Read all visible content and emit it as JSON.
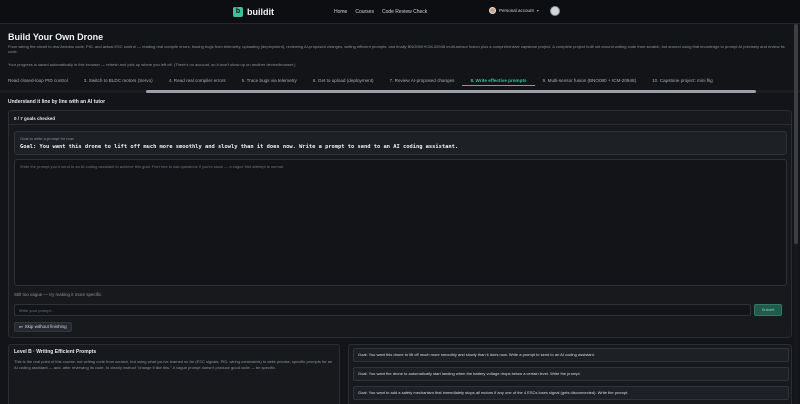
{
  "brand": {
    "logo_letter": "b",
    "name": "buildit"
  },
  "nav": {
    "links": [
      "Home",
      "Courses",
      "Code Review Check"
    ]
  },
  "account": {
    "label": "Personal account"
  },
  "page": {
    "title": "Build Your Own Drone",
    "intro": "From wiring the circuit to real Arduino code, PID, and actual ESC control — reading real compile errors, tracing bugs from telemetry, uploading (deployment), reviewing AI-proposed changes, writing efficient prompts, and finally BNO080+ICM-20948 multi-sensor fusion plus a comprehensive capstone project. A complete project built not around writing code from scratch, but around using that knowledge to prompt AI precisely and review its code.",
    "progress_note": "Your progress is saved automatically in this browser — refresh and pick up where you left off. (There's no account, so it won't show up on another device/browser.)"
  },
  "tabs": [
    "Read closed-loop PID control",
    "3. Switch to BLDC motors (Servo)",
    "4. Read real compiler errors",
    "5. Trace bugs via telemetry",
    "6. Get to upload (deployment)",
    "7. Review AI-proposed changes",
    "8. Write effective prompts",
    "9. Multi-sensor fusion (BNO080 + ICM-20948)",
    "10. Capstone project: mini flig"
  ],
  "active_tab_index": 6,
  "tutor": {
    "section_title": "Understand it line by line with an AI tutor",
    "goals_checked": "0 / 7 goals checked",
    "goal_caption": "Goal to write a prompt for now",
    "goal_text": "Goal: You want this drone to lift off much more smoothly and slowly than it does now. Write a prompt to send to an AI coding assistant.",
    "prompt_placeholder": "Write the prompt you'd send to an AI coding assistant to achieve this goal. Feel free to ask questions if you're stuck — a vague first attempt is normal.",
    "prompt_value": "",
    "feedback": "Still too vague — try making it more specific.",
    "message_placeholder": "Write your prompt...",
    "submit_label": "Submit",
    "skip_label": "Skip without finishing"
  },
  "level": {
    "title": "Level B · Writing Efficient Prompts",
    "description": "This is the real point of this course: not writing code from scratch, but using what you've learned so far (ESC signals, PID, wiring constraints) to write precise, specific prompts for an AI coding assistant — and, after reviewing its code, to clearly instruct \"change it like this.\" A vague prompt doesn't produce good code — be specific."
  },
  "goal_list": [
    "Goal: You want this drone to lift off much more smoothly and slowly than it does now. Write a prompt to send to an AI coding assistant.",
    "Goal: You want the drone to automatically start landing when the battery voltage drops below a certain level. Write the prompt.",
    "Goal: You want to add a safety mechanism that immediately stops all motors if any one of the 4 ESCs loses signal (gets disconnected). Write the prompt."
  ],
  "icons": {
    "caret": "caret-down-icon",
    "skip": "skip-icon"
  },
  "colors": {
    "accent": "#3fbf9a",
    "background": "#121417"
  }
}
